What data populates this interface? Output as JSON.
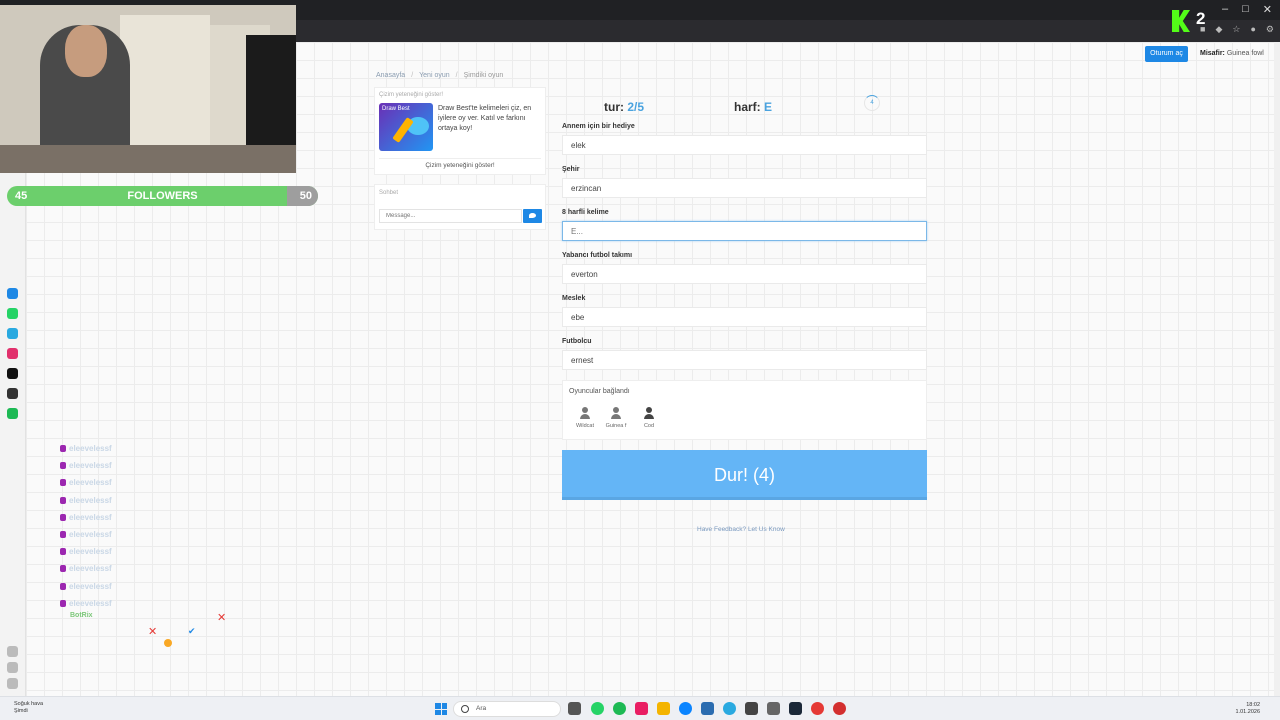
{
  "header": {
    "login_label": "Oturum aç",
    "guest_prefix": "Misafir:",
    "guest_name": "Guinea fowl"
  },
  "breadcrumb": {
    "home": "Anasayfa",
    "new_game": "Yeni oyun",
    "current": "Şimdiki oyun"
  },
  "promo": {
    "header": "Çizim yeteneğini göster!",
    "image_label": "Draw Best",
    "text": "Draw Best'te kelimeleri çiz, en iyilere oy ver. Katıl ve farkını ortaya koy!",
    "button": "Çizim yeteneğini göster!"
  },
  "chat": {
    "header": "Sohbet",
    "placeholder": "Message..."
  },
  "game": {
    "round_label": "tur:",
    "round_value": "2/5",
    "letter_label": "harf:",
    "letter_value": "E",
    "timer": "4"
  },
  "fields": [
    {
      "label": "Annem için bir hediye",
      "value": "elek"
    },
    {
      "label": "Şehir",
      "value": "erzincan"
    },
    {
      "label": "8 harfli kelime",
      "value": "E..."
    },
    {
      "label": "Yabancı futbol takımı",
      "value": "everton"
    },
    {
      "label": "Meslek",
      "value": "ebe"
    },
    {
      "label": "Futbolcu",
      "value": "ernest"
    }
  ],
  "players": {
    "title": "Oyuncular bağlandı",
    "list": [
      {
        "name": "Wildcat"
      },
      {
        "name": "Guinea f"
      },
      {
        "name": "Cod"
      }
    ]
  },
  "stop_button": "Dur! (4)",
  "feedback": "Have Feedback? Let Us Know",
  "overlay": {
    "followers_current": "45",
    "followers_label": "FOLLOWERS",
    "followers_goal": "50",
    "followers_progress_fraction": 0.9,
    "kick_count": "2",
    "kick_brand_color": "#53fc18",
    "social_handle": "eleevelessf",
    "bot_label": "BotRix"
  },
  "taskbar": {
    "weather": "Soğuk hava",
    "weather_sub": "Şimdi",
    "search": "Ara",
    "time": "18:02",
    "date": "1.01.2026"
  },
  "colors": {
    "accent": "#1e88e5",
    "button": "#64b5f6",
    "highlight": "#4aa3df"
  }
}
